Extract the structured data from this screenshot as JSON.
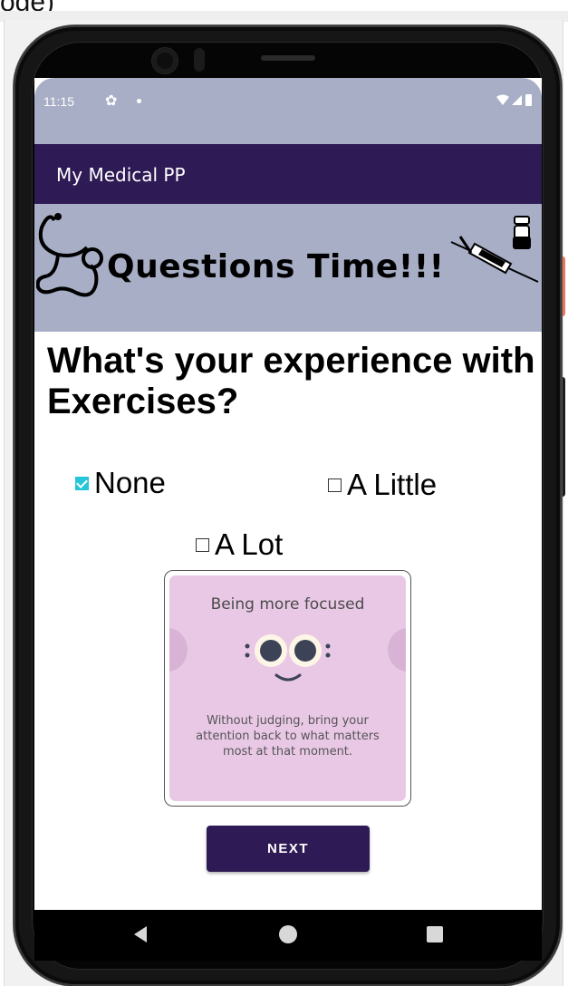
{
  "page": {
    "top_cut_text": "oge)"
  },
  "status_bar": {
    "time": "11:15",
    "gear_icon": "gear-icon",
    "signal_icons": "▾◢▮"
  },
  "app_bar": {
    "title": "My Medical PP"
  },
  "banner": {
    "title": "Questions Time!!!"
  },
  "question": {
    "text": "What's your experience with Exercises?"
  },
  "options": [
    {
      "label": "None",
      "checked": true
    },
    {
      "label": "A Little",
      "checked": false
    },
    {
      "label": "A Lot",
      "checked": false
    }
  ],
  "card": {
    "heading": "Being more focused",
    "body": "Without judging, bring your attention back to what matters most at that moment."
  },
  "buttons": {
    "next_label": "NEXT"
  },
  "colors": {
    "primary": "#2e1a54",
    "banner": "#a8aec6",
    "card": "#e9c8e6",
    "checkbox": "#26c6da"
  }
}
